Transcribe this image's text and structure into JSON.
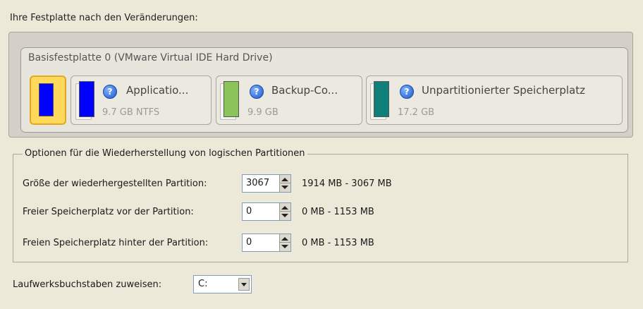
{
  "header": {
    "label": "Ihre Festplatte nach den Veränderungen:"
  },
  "disk": {
    "title": "Basisfestplatte 0 (VMware Virtual IDE Hard Drive)",
    "partitions": [
      {
        "name": "",
        "size": "",
        "color": "#0000ff",
        "selected": true
      },
      {
        "name": "Applicatio...",
        "size": "9.7 GB NTFS",
        "color": "#0000ff",
        "selected": false
      },
      {
        "name": "Backup-Co...",
        "size": "9.9 GB",
        "color": "#8bc55a",
        "selected": false
      },
      {
        "name": "Unpartitionierter Speicherplatz",
        "size": "17.2 GB",
        "color": "#0f7f7a",
        "selected": false
      }
    ]
  },
  "options": {
    "legend": "Optionen für die Wiederherstellung von logischen Partitionen",
    "rows": [
      {
        "label": "Größe der wiederhergestellten Partition:",
        "value": "3067",
        "range": "1914 MB - 3067 MB"
      },
      {
        "label": "Freier Speicherplatz vor der Partition:",
        "value": "0",
        "range": "0 MB - 1153 MB"
      },
      {
        "label": "Freien Speicherplatz hinter der Partition:",
        "value": "0",
        "range": "0 MB - 1153 MB"
      }
    ]
  },
  "drive_letter": {
    "label": "Laufwerksbuchstaben zuweisen:",
    "value": "C:"
  },
  "icons": {
    "help": "help-icon",
    "dropdown": "chevron-down-icon",
    "spinner": "spinner-arrows-icon"
  }
}
